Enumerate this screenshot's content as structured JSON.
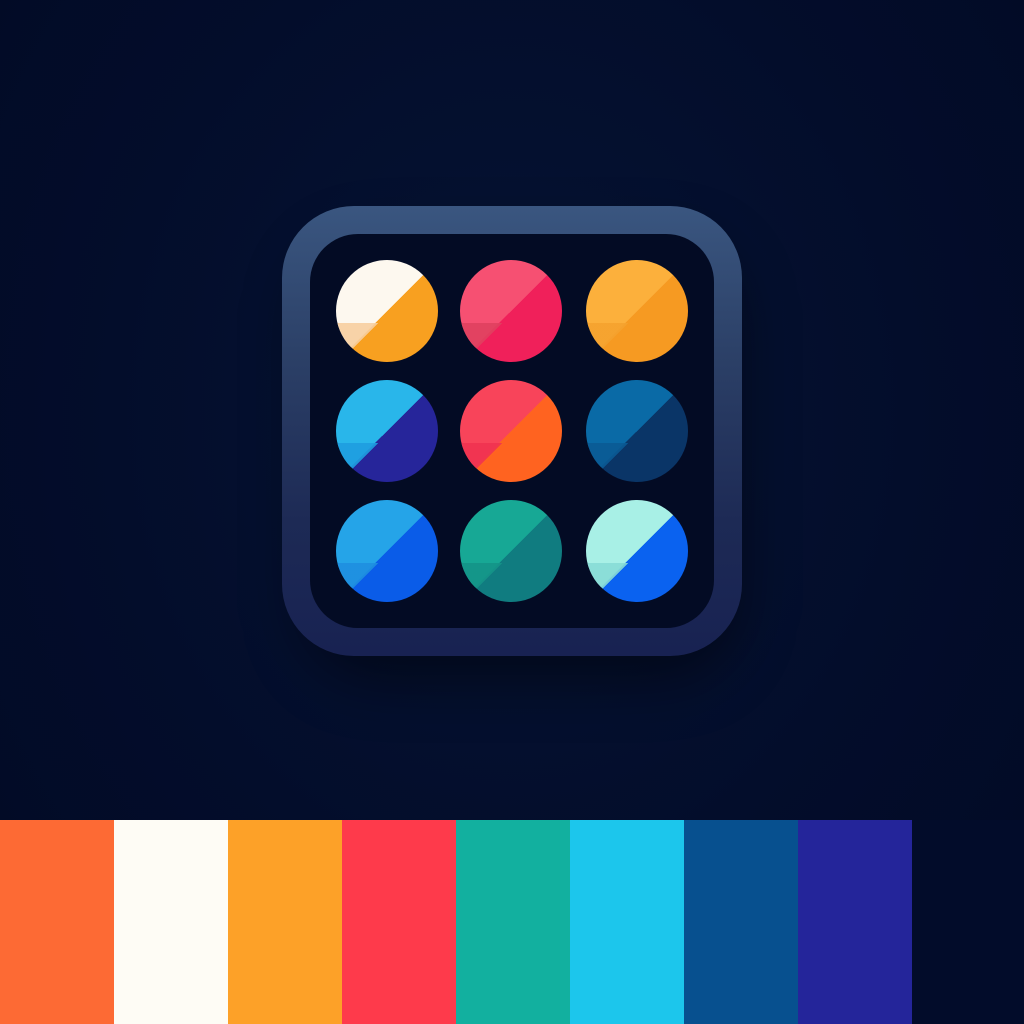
{
  "app_icon": {
    "frame_color": "#2b3f66",
    "inner_color": "#030b24",
    "dots": [
      {
        "name": "dot-white-orange",
        "light": "#fdf8ef",
        "shade": "#f7cfa0",
        "dark": "#f8a020"
      },
      {
        "name": "dot-pink-red",
        "light": "#f65072",
        "shade": "#e0405f",
        "dark": "#f0205a"
      },
      {
        "name": "dot-amber",
        "light": "#fcb03c",
        "shade": "#f5a22e",
        "dark": "#f69a22"
      },
      {
        "name": "dot-cyan-indigo",
        "light": "#29b6ea",
        "shade": "#1e9ee0",
        "dark": "#26259a"
      },
      {
        "name": "dot-red-orange",
        "light": "#f8445a",
        "shade": "#f03250",
        "dark": "#ff6320"
      },
      {
        "name": "dot-blue-navy",
        "light": "#0a6aa6",
        "shade": "#0a5a94",
        "dark": "#0a3567"
      },
      {
        "name": "dot-sky-blue",
        "light": "#25a4e8",
        "shade": "#1e8fe0",
        "dark": "#0a5ce8"
      },
      {
        "name": "dot-teal",
        "light": "#17a895",
        "shade": "#149488",
        "dark": "#107c80"
      },
      {
        "name": "dot-mint-blue",
        "light": "#a8f0e6",
        "shade": "#88dcd6",
        "dark": "#0a62f0"
      }
    ]
  },
  "palette": {
    "swatches": [
      {
        "name": "swatch-orange",
        "color": "#fd6a34"
      },
      {
        "name": "swatch-cream",
        "color": "#fefcf5"
      },
      {
        "name": "swatch-amber",
        "color": "#fda128"
      },
      {
        "name": "swatch-red",
        "color": "#fe3a4b"
      },
      {
        "name": "swatch-teal",
        "color": "#12b09f"
      },
      {
        "name": "swatch-cyan",
        "color": "#1cc6ec"
      },
      {
        "name": "swatch-blue",
        "color": "#07508f"
      },
      {
        "name": "swatch-indigo",
        "color": "#24259a"
      },
      {
        "name": "swatch-navy",
        "color": "#020c2a"
      }
    ]
  }
}
